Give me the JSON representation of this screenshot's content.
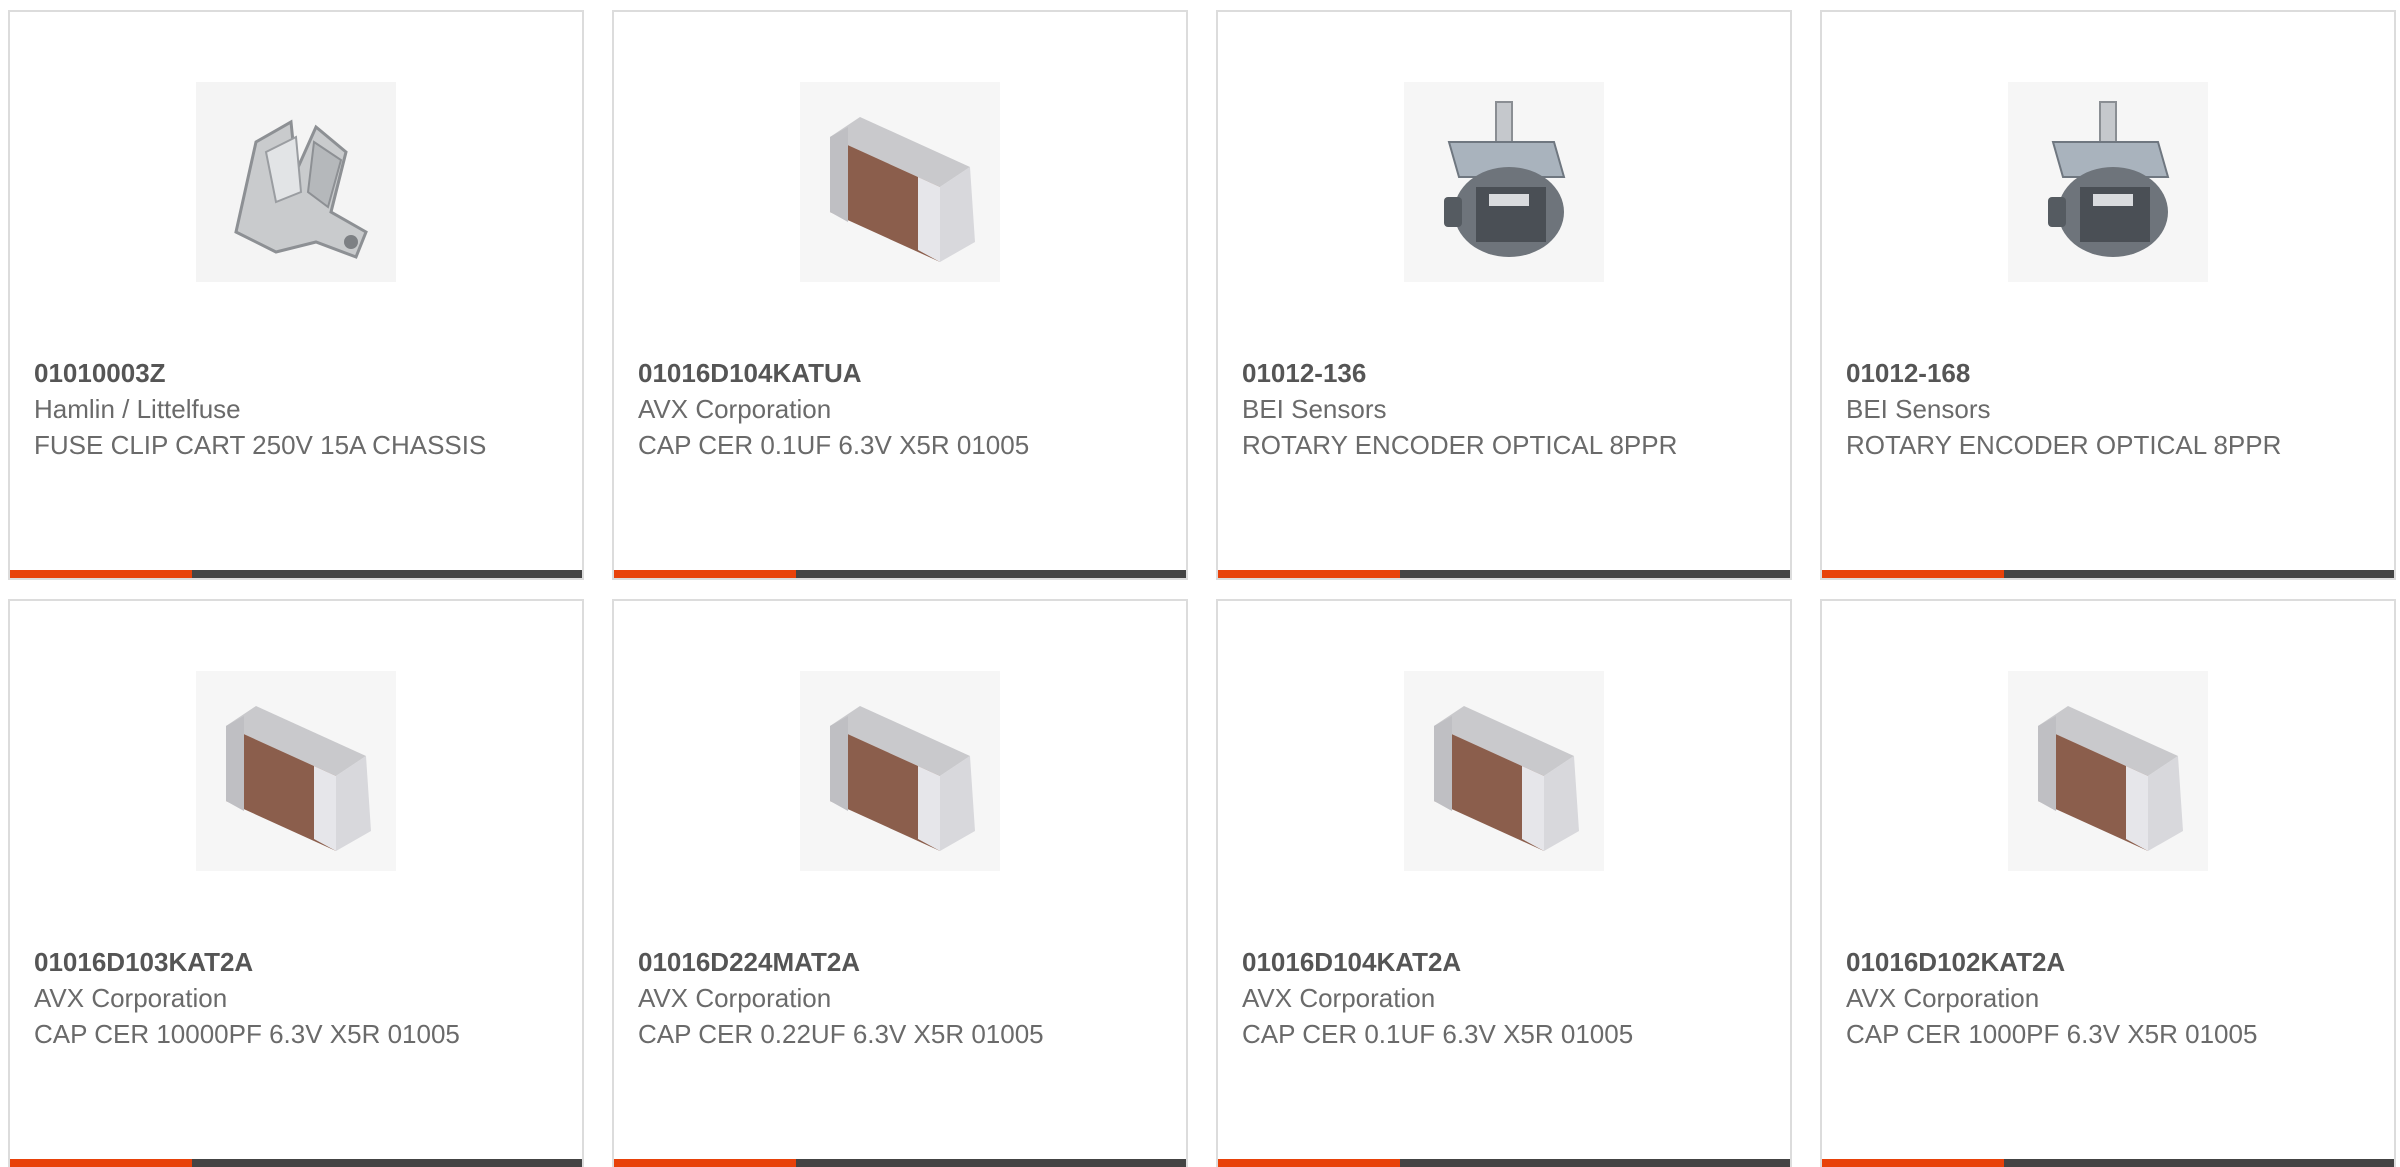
{
  "colors": {
    "accent": "#e8420a",
    "bar": "#444444",
    "border": "#dcdcdc",
    "part_number": "#555555",
    "text": "#6a6a6a"
  },
  "products": [
    {
      "part_number": "01010003Z",
      "manufacturer": "Hamlin / Littelfuse",
      "description": "FUSE CLIP CART 250V 15A CHASSIS",
      "image": "fuse-clip-image"
    },
    {
      "part_number": "01016D104KATUA",
      "manufacturer": "AVX Corporation",
      "description": "CAP CER 0.1UF 6.3V X5R 01005",
      "image": "ceramic-capacitor-image"
    },
    {
      "part_number": "01012-136",
      "manufacturer": "BEI Sensors",
      "description": "ROTARY ENCODER OPTICAL 8PPR",
      "image": "rotary-encoder-image"
    },
    {
      "part_number": "01012-168",
      "manufacturer": "BEI Sensors",
      "description": "ROTARY ENCODER OPTICAL 8PPR",
      "image": "rotary-encoder-image"
    },
    {
      "part_number": "01016D103KAT2A",
      "manufacturer": "AVX Corporation",
      "description": "CAP CER 10000PF 6.3V X5R 01005",
      "image": "ceramic-capacitor-image"
    },
    {
      "part_number": "01016D224MAT2A",
      "manufacturer": "AVX Corporation",
      "description": "CAP CER 0.22UF 6.3V X5R 01005",
      "image": "ceramic-capacitor-image"
    },
    {
      "part_number": "01016D104KAT2A",
      "manufacturer": "AVX Corporation",
      "description": "CAP CER 0.1UF 6.3V X5R 01005",
      "image": "ceramic-capacitor-image"
    },
    {
      "part_number": "01016D102KAT2A",
      "manufacturer": "AVX Corporation",
      "description": "CAP CER 1000PF 6.3V X5R 01005",
      "image": "ceramic-capacitor-image"
    }
  ]
}
